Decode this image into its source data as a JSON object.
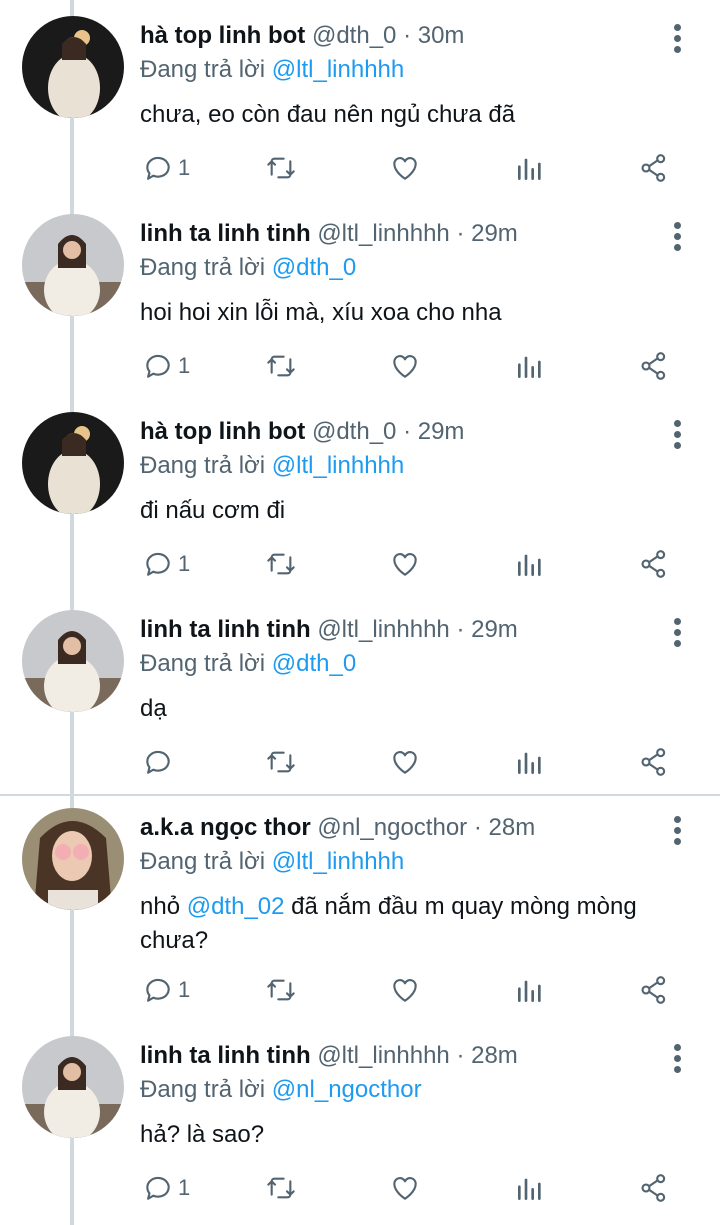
{
  "thread": [
    {
      "name": "hà top linh bot",
      "handle": "@dth_0",
      "time": "30m",
      "reply_prefix": "Đang trả lời",
      "reply_to": "@ltl_linhhhh",
      "text_parts": [
        "chưa, eo còn đau nên ngủ chưa đã"
      ],
      "reply_count": "1",
      "avatar": "avatar-dark-background"
    },
    {
      "name": "linh ta linh tinh",
      "handle": "@ltl_linhhhh",
      "time": "29m",
      "reply_prefix": "Đang trả lời",
      "reply_to": "@dth_0",
      "text_parts": [
        "hoi hoi xin lỗi mà, xíu xoa cho nha"
      ],
      "reply_count": "1",
      "avatar": "avatar-light-background"
    },
    {
      "name": "hà top linh bot",
      "handle": "@dth_0",
      "time": "29m",
      "reply_prefix": "Đang trả lời",
      "reply_to": "@ltl_linhhhh",
      "text_parts": [
        "đi nấu cơm đi"
      ],
      "reply_count": "1",
      "avatar": "avatar-dark-background"
    },
    {
      "name": "linh ta linh tinh",
      "handle": "@ltl_linhhhh",
      "time": "29m",
      "reply_prefix": "Đang trả lời",
      "reply_to": "@dth_0",
      "text_parts": [
        "dạ"
      ],
      "reply_count": "",
      "avatar": "avatar-light-background"
    },
    {
      "name": "a.k.a ngọc thor",
      "handle": "@nl_ngocthor",
      "time": "28m",
      "reply_prefix": "Đang trả lời",
      "reply_to": "@ltl_linhhhh",
      "text_parts": [
        "nhỏ ",
        "@dth_02",
        " đã nắm đầu m quay mòng mòng chưa?"
      ],
      "reply_count": "1",
      "avatar": "avatar-pink-glasses"
    },
    {
      "name": "linh ta linh tinh",
      "handle": "@ltl_linhhhh",
      "time": "28m",
      "reply_prefix": "Đang trả lời",
      "reply_to": "@nl_ngocthor",
      "text_parts": [
        "hả? là sao?"
      ],
      "reply_count": "1",
      "avatar": "avatar-light-background"
    }
  ],
  "colors": {
    "text": "#0f1419",
    "secondary": "#536471",
    "accent": "#1d9bf0",
    "line": "#cfd9de"
  },
  "icons": [
    "reply-icon",
    "retweet-icon",
    "like-icon",
    "analytics-icon",
    "share-icon",
    "more-icon"
  ]
}
